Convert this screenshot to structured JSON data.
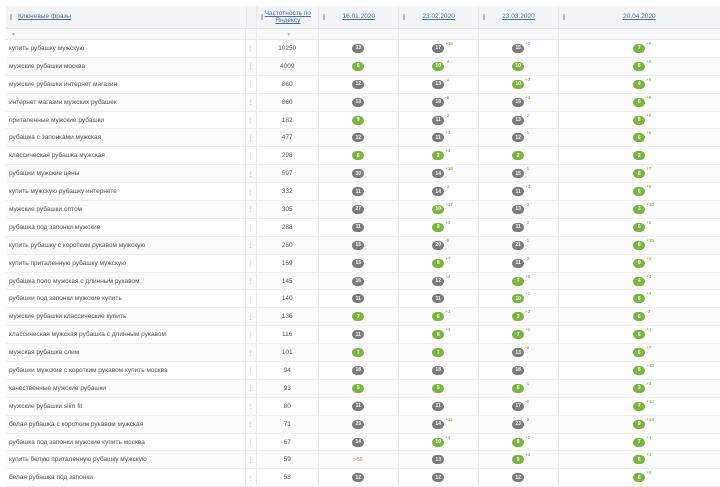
{
  "colors": {
    "green": "#7cb342",
    "gray": "#7a7a7a",
    "change_up": "#5aa02c",
    "change_down": "#e0664a",
    "header_link": "#4a6f9c"
  },
  "header": {
    "phrase": "Ключевые фразы",
    "frequency": "Частотность по Яндексу",
    "dates": [
      "16.01.2020",
      "23.02.2020",
      "23.03.2020",
      "20.04.2020"
    ]
  },
  "rows": [
    {
      "phrase": "купить рубашку мужскую",
      "freq": "10250",
      "d": [
        {
          "v": "33",
          "c": "gray"
        },
        {
          "v": "17",
          "c": "gray",
          "ch": "+16"
        },
        {
          "v": "15",
          "c": "gray",
          "ch": "+2"
        },
        {
          "v": "7",
          "c": "green",
          "ch": "+8"
        }
      ]
    },
    {
      "phrase": "мужские рубашки москва",
      "freq": "4009",
      "d": [
        {
          "v": "6",
          "c": "green"
        },
        {
          "v": "10",
          "c": "green",
          "ch": "-4"
        },
        {
          "v": "10",
          "c": "green"
        },
        {
          "v": "5",
          "c": "green",
          "ch": "+5"
        }
      ]
    },
    {
      "phrase": "мужские рубашки интернет магазин",
      "freq": "860",
      "d": [
        {
          "v": "12",
          "c": "gray"
        },
        {
          "v": "13",
          "c": "gray",
          "ch": "-1"
        },
        {
          "v": "10",
          "c": "green",
          "ch": "+3"
        },
        {
          "v": "4",
          "c": "green",
          "ch": "+6"
        }
      ]
    },
    {
      "phrase": "интернет магазин мужских рубашек",
      "freq": "860",
      "d": [
        {
          "v": "13",
          "c": "gray"
        },
        {
          "v": "18",
          "c": "gray",
          "ch": "-5"
        },
        {
          "v": "15",
          "c": "gray",
          "ch": "+3"
        },
        {
          "v": "6",
          "c": "green",
          "ch": "+9"
        }
      ]
    },
    {
      "phrase": "приталенные мужские рубашки",
      "freq": "182",
      "d": [
        {
          "v": "9",
          "c": "green"
        },
        {
          "v": "11",
          "c": "gray",
          "ch": "-2"
        },
        {
          "v": "13",
          "c": "gray",
          "ch": "-2"
        },
        {
          "v": "8",
          "c": "green",
          "ch": "+5"
        }
      ]
    },
    {
      "phrase": "рубашка с запонками мужская",
      "freq": "477",
      "d": [
        {
          "v": "12",
          "c": "gray"
        },
        {
          "v": "11",
          "c": "gray",
          "ch": "+1"
        },
        {
          "v": "12",
          "c": "gray",
          "ch": "-1"
        },
        {
          "v": "6",
          "c": "green",
          "ch": "+6"
        }
      ]
    },
    {
      "phrase": "классическая рубашка мужская",
      "freq": "298",
      "d": [
        {
          "v": "6",
          "c": "green"
        },
        {
          "v": "2",
          "c": "green",
          "ch": "+4"
        },
        {
          "v": "2",
          "c": "green"
        },
        {
          "v": "2",
          "c": "green"
        }
      ]
    },
    {
      "phrase": "рубашки мужские цены",
      "freq": "597",
      "d": [
        {
          "v": "30",
          "c": "gray"
        },
        {
          "v": "14",
          "c": "gray",
          "ch": "+16"
        },
        {
          "v": "15",
          "c": "gray",
          "ch": "-1"
        },
        {
          "v": "8",
          "c": "green",
          "ch": "+7"
        }
      ]
    },
    {
      "phrase": "купить мужскую рубашку интернете",
      "freq": "332",
      "d": [
        {
          "v": "11",
          "c": "gray"
        },
        {
          "v": "14",
          "c": "gray",
          "ch": "-3"
        },
        {
          "v": "11",
          "c": "gray",
          "ch": "+3"
        },
        {
          "v": "6",
          "c": "green",
          "ch": "+5"
        }
      ]
    },
    {
      "phrase": "мужские рубашки оптом",
      "freq": "305",
      "d": [
        {
          "v": "27",
          "c": "gray"
        },
        {
          "v": "10",
          "c": "green",
          "ch": "+17"
        },
        {
          "v": "13",
          "c": "gray",
          "ch": "-3"
        },
        {
          "v": "3",
          "c": "green",
          "ch": "+10"
        }
      ]
    },
    {
      "phrase": "рубашка под запонки мужские",
      "freq": "288",
      "d": [
        {
          "v": "11",
          "c": "gray"
        },
        {
          "v": "9",
          "c": "green",
          "ch": "+2"
        },
        {
          "v": "11",
          "c": "gray",
          "ch": "-2"
        },
        {
          "v": "6",
          "c": "green",
          "ch": "+5"
        }
      ]
    },
    {
      "phrase": "купить рубашку с коротким рукавом мужскую",
      "freq": "250",
      "d": [
        {
          "v": "15",
          "c": "gray"
        },
        {
          "v": "20",
          "c": "gray",
          "ch": "-5"
        },
        {
          "v": "21",
          "c": "gray",
          "ch": "-1"
        },
        {
          "v": "6",
          "c": "green",
          "ch": "+15"
        }
      ]
    },
    {
      "phrase": "купить приталенную рубашку мужскую",
      "freq": "169",
      "d": [
        {
          "v": "15",
          "c": "gray"
        },
        {
          "v": "8",
          "c": "green",
          "ch": "+7"
        },
        {
          "v": "11",
          "c": "gray",
          "ch": "-3"
        },
        {
          "v": "9",
          "c": "green",
          "ch": "+2"
        }
      ]
    },
    {
      "phrase": "рубашка поло мужская с длинным рукавом",
      "freq": "145",
      "d": [
        {
          "v": "16",
          "c": "gray"
        },
        {
          "v": "12",
          "c": "gray",
          "ch": "+4"
        },
        {
          "v": "7",
          "c": "green",
          "ch": "+5"
        },
        {
          "v": "4",
          "c": "green",
          "ch": "+3"
        }
      ]
    },
    {
      "phrase": "рубашки под запонки мужские купить",
      "freq": "140",
      "d": [
        {
          "v": "11",
          "c": "gray"
        },
        {
          "v": "11",
          "c": "gray"
        },
        {
          "v": "10",
          "c": "green",
          "ch": "+1"
        },
        {
          "v": "6",
          "c": "green",
          "ch": "+4"
        }
      ]
    },
    {
      "phrase": "мужские рубашки классические купить",
      "freq": "136",
      "d": [
        {
          "v": "7",
          "c": "green"
        },
        {
          "v": "6",
          "c": "green",
          "ch": "+1"
        },
        {
          "v": "3",
          "c": "green",
          "ch": "+3"
        },
        {
          "v": "6",
          "c": "green",
          "ch": "-3"
        }
      ]
    },
    {
      "phrase": "классическая мужская рубашка с длинным рукавом",
      "freq": "116",
      "d": [
        {
          "v": "11",
          "c": "gray"
        },
        {
          "v": "8",
          "c": "green",
          "ch": "+3"
        },
        {
          "v": "7",
          "c": "green",
          "ch": "+1"
        },
        {
          "v": "6",
          "c": "green",
          "ch": "+1"
        }
      ]
    },
    {
      "phrase": "мужская рубашка слим",
      "freq": "101",
      "d": [
        {
          "v": "7",
          "c": "green"
        },
        {
          "v": "7",
          "c": "green"
        },
        {
          "v": "13",
          "c": "gray",
          "ch": "-6"
        },
        {
          "v": "6",
          "c": "green",
          "ch": "+7"
        }
      ]
    },
    {
      "phrase": "рубашки мужские с коротким рукавом купить москва",
      "freq": "94",
      "d": [
        {
          "v": "18",
          "c": "gray"
        },
        {
          "v": "18",
          "c": "gray"
        },
        {
          "v": "18",
          "c": "gray"
        },
        {
          "v": "8",
          "c": "green",
          "ch": "+10"
        }
      ]
    },
    {
      "phrase": "качественные мужские рубашки",
      "freq": "93",
      "d": [
        {
          "v": "5",
          "c": "green"
        },
        {
          "v": "5",
          "c": "green"
        },
        {
          "v": "6",
          "c": "green",
          "ch": "-1"
        },
        {
          "v": "3",
          "c": "green",
          "ch": "+3"
        }
      ]
    },
    {
      "phrase": "мужские рубашки slim fit",
      "freq": "80",
      "d": [
        {
          "v": "11",
          "c": "gray"
        },
        {
          "v": "11",
          "c": "gray"
        },
        {
          "v": "17",
          "c": "gray",
          "ch": "-6"
        },
        {
          "v": "7",
          "c": "green",
          "ch": "+10"
        }
      ]
    },
    {
      "phrase": "белая рубашка с коротким рукавом мужская",
      "freq": "71",
      "d": [
        {
          "v": "25",
          "c": "gray"
        },
        {
          "v": "14",
          "c": "gray",
          "ch": "+11"
        },
        {
          "v": "23",
          "c": "gray",
          "ch": "-9"
        },
        {
          "v": "9",
          "c": "green",
          "ch": "+14"
        }
      ]
    },
    {
      "phrase": "рубашка под запонки мужские купить москва",
      "freq": "67",
      "d": [
        {
          "v": "14",
          "c": "gray"
        },
        {
          "v": "10",
          "c": "green",
          "ch": "+4"
        },
        {
          "v": "8",
          "c": "green",
          "ch": "+2"
        },
        {
          "v": "7",
          "c": "green",
          "ch": "+1"
        }
      ]
    },
    {
      "phrase": "купить белую приталенную рубашку мужскую",
      "freq": "59",
      "d": [
        {
          "v": ">50",
          "c": "none"
        },
        {
          "v": "13",
          "c": "gray"
        },
        {
          "v": "9",
          "c": "green",
          "ch": "+4"
        },
        {
          "v": "6",
          "c": "green",
          "ch": "+3"
        }
      ]
    },
    {
      "phrase": "белая рубашка под запонки",
      "freq": "58",
      "d": [
        {
          "v": "12",
          "c": "gray"
        },
        {
          "v": "12",
          "c": "gray"
        },
        {
          "v": "12",
          "c": "gray"
        },
        {
          "v": "6",
          "c": "green",
          "ch": "+6"
        }
      ]
    }
  ]
}
